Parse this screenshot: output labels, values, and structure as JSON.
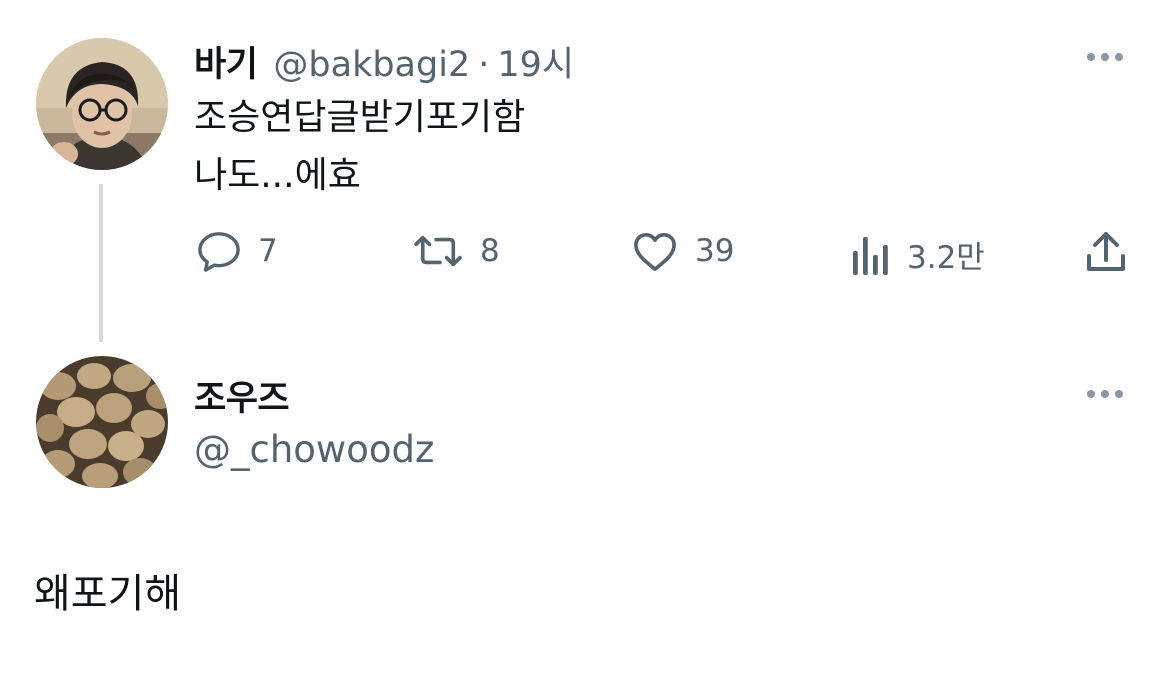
{
  "parent_tweet": {
    "display_name": "바기",
    "handle": "@bakbagi2",
    "separator": "·",
    "time": "19시",
    "text_lines": [
      "조승연답글받기포기함",
      "나도...에효"
    ],
    "avatar_icon": "person-avatar-icon",
    "actions": {
      "reply_count": "7",
      "retweet_count": "8",
      "like_count": "39",
      "view_count": "3.2만"
    }
  },
  "reply_tweet": {
    "display_name": "조우즈",
    "handle": "@_chowoodz",
    "text": "왜포기해",
    "avatar_icon": "potatoes-avatar-icon"
  },
  "colors": {
    "text_primary": "#0f1419",
    "text_secondary": "#536471",
    "thread_line": "#cfd9de",
    "background": "#ffffff"
  }
}
